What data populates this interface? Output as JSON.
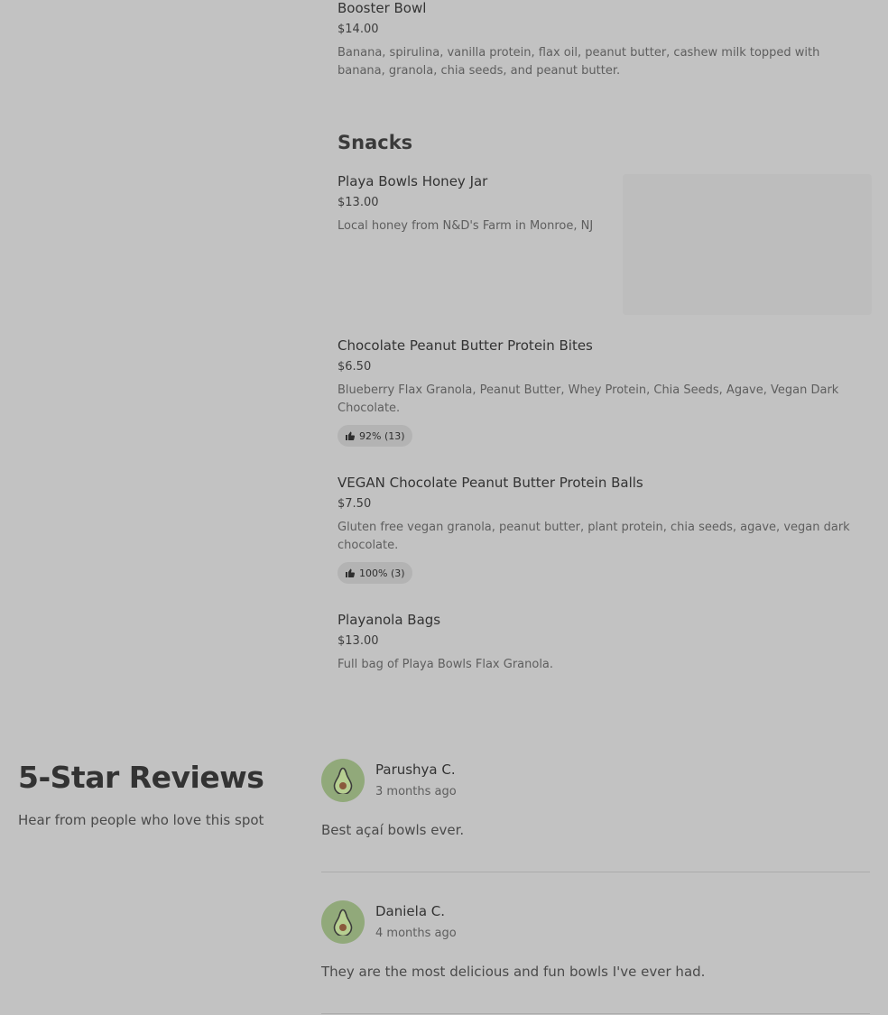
{
  "menu": {
    "items_top": [
      {
        "name": "Booster Bowl",
        "price": "$14.00",
        "desc": "Banana, spirulina, vanilla protein, flax oil, peanut butter, cashew milk topped with banana, granola, chia seeds, and peanut butter."
      }
    ],
    "snacks": {
      "title": "Snacks",
      "items": [
        {
          "name": "Playa Bowls Honey Jar",
          "price": "$13.00",
          "desc": "Local honey from N&D's Farm in Monroe, NJ"
        },
        {
          "name": "Chocolate Peanut Butter Protein Bites",
          "price": "$6.50",
          "desc": "Blueberry Flax Granola, Peanut Butter, Whey Protein, Chia Seeds, Agave, Vegan Dark Chocolate.",
          "rating": "92% (13)"
        },
        {
          "name": "VEGAN Chocolate Peanut Butter Protein Balls",
          "price": "$7.50",
          "desc": "Gluten free vegan granola, peanut butter, plant protein, chia seeds, agave, vegan dark chocolate.",
          "rating": "100% (3)"
        },
        {
          "name": "Playanola Bags",
          "price": "$13.00",
          "desc": "Full bag of Playa Bowls Flax Granola."
        }
      ]
    }
  },
  "reviews": {
    "title": "5-Star Reviews",
    "subtitle": "Hear from people who love this spot",
    "items": [
      {
        "name": "Parushya C.",
        "time": "3 months ago",
        "text": "Best açaí bowls ever."
      },
      {
        "name": "Daniela C.",
        "time": "4 months ago",
        "text": "They are the most delicious and fun bowls I've ever had."
      }
    ]
  },
  "icons": {
    "rating": "thumbs-up-icon",
    "avatar": "avocado-icon"
  },
  "colors": {
    "background": "#c2c2c2",
    "avatar": "#91a97a"
  }
}
